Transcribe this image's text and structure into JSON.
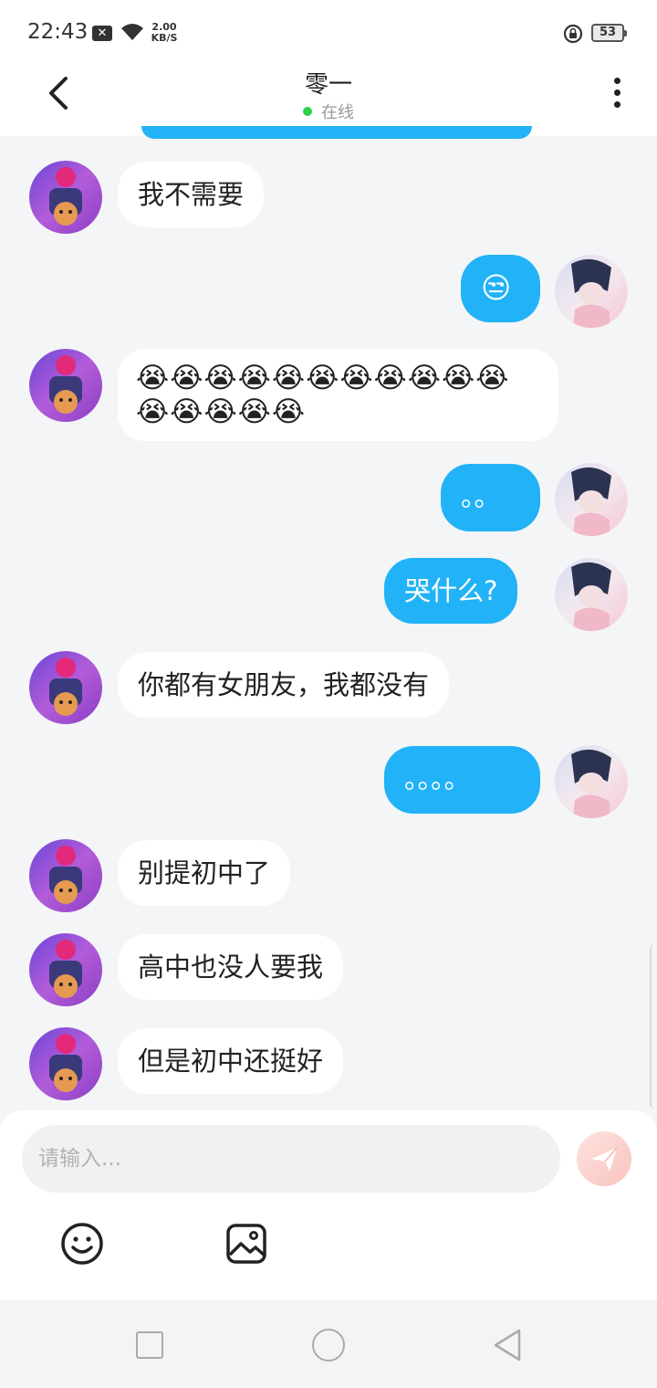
{
  "status_bar": {
    "time": "22:43",
    "notif_icon": "x-box-icon",
    "net_speed_value": "2.00",
    "net_speed_unit": "KB/S",
    "battery": "53"
  },
  "header": {
    "title": "零一",
    "status": "在线",
    "status_color": "#2fd14b"
  },
  "messages": [
    {
      "side": "in",
      "text": "我不需要"
    },
    {
      "side": "out",
      "text": "😒"
    },
    {
      "side": "in",
      "text": "😭😭😭😭😭😭😭😭😭😭😭😭😭😭😭😭"
    },
    {
      "side": "out",
      "text": "。。"
    },
    {
      "side": "out",
      "text": "哭什么?"
    },
    {
      "side": "in",
      "text": "你都有女朋友，我都没有"
    },
    {
      "side": "out",
      "text": "。。。。"
    },
    {
      "side": "in",
      "text": "别提初中了"
    },
    {
      "side": "in",
      "text": "高中也没人要我"
    },
    {
      "side": "in",
      "text": "但是初中还挺好"
    }
  ],
  "composer": {
    "placeholder": "请输入..."
  },
  "colors": {
    "outgoing_bubble": "#21b2f7",
    "incoming_bubble": "#ffffff",
    "background": "#f4f5f7"
  }
}
